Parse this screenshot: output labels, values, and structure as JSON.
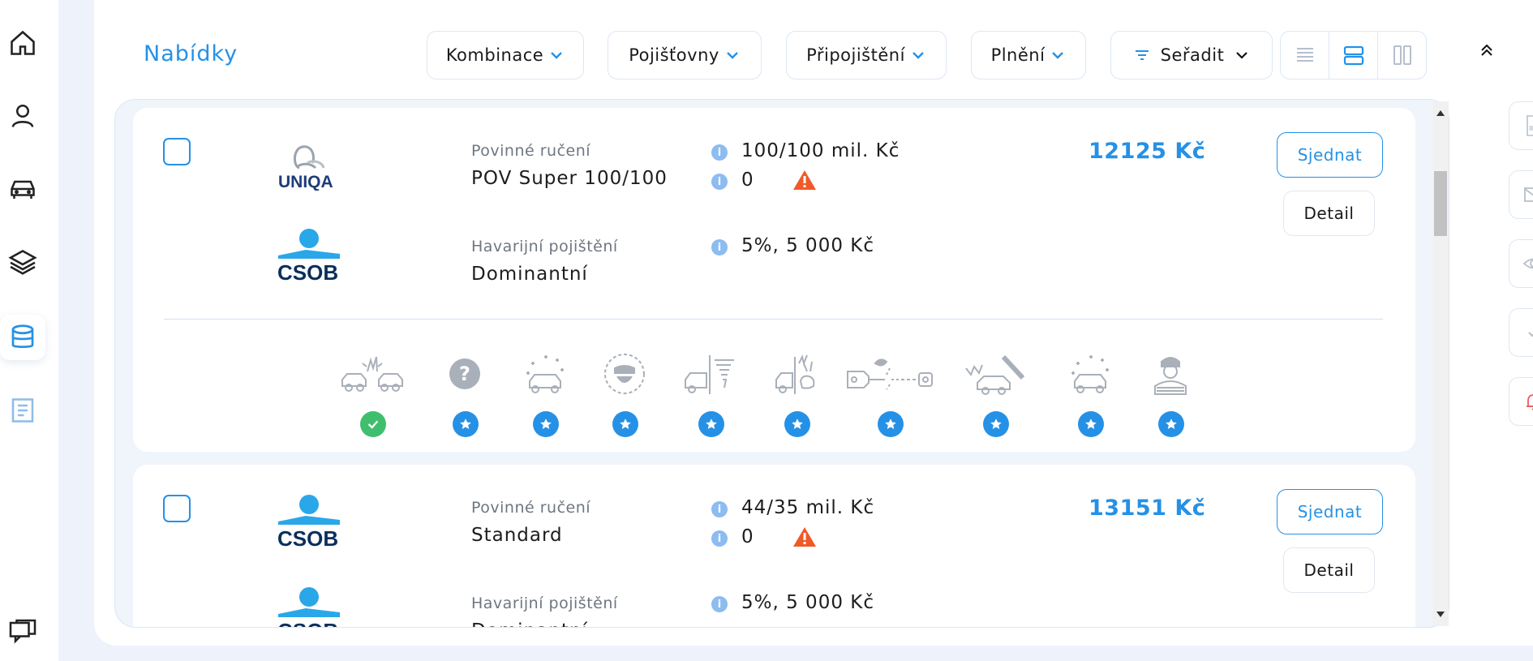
{
  "header": {
    "title": "Nabídky",
    "filters": [
      {
        "label": "Kombinace"
      },
      {
        "label": "Pojišťovny"
      },
      {
        "label": "Připojištění"
      },
      {
        "label": "Plnění"
      }
    ],
    "sort_label": "Seřadit"
  },
  "nav": {
    "items": [
      "home-icon",
      "user-icon",
      "car-icon",
      "layers-icon",
      "database-icon",
      "document-icon",
      "chat-icon"
    ],
    "active": "database-icon"
  },
  "right_rail": [
    "pdf-icon",
    "mail-icon",
    "eye-icon",
    "check-icon",
    "bell-icon"
  ],
  "offers": [
    {
      "mtpl": {
        "insurer": "UNIQA",
        "type_label": "Povinné ručení",
        "product": "POV Super 100/100",
        "limit": "100/100 mil. Kč",
        "deductible": "0"
      },
      "casco": {
        "insurer": "CSOB",
        "type_label": "Havarijní pojištění",
        "product": "Dominantní",
        "deductible": "5%, 5 000 Kč"
      },
      "price": "12125 Kč",
      "actions": {
        "primary": "Sjednat",
        "secondary": "Detail"
      },
      "features": [
        {
          "icon": "collision-icon",
          "status": "included"
        },
        {
          "icon": "question-icon",
          "status": "star"
        },
        {
          "icon": "natural-disaster-icon",
          "status": "star"
        },
        {
          "icon": "theft-icon",
          "status": "star"
        },
        {
          "icon": "storm-tornado-icon",
          "status": "star"
        },
        {
          "icon": "animal-collision-icon",
          "status": "star"
        },
        {
          "icon": "cable-damage-icon",
          "status": "star"
        },
        {
          "icon": "vandalism-icon",
          "status": "star"
        },
        {
          "icon": "hail-icon",
          "status": "star"
        },
        {
          "icon": "thief-icon",
          "status": "star"
        }
      ]
    },
    {
      "mtpl": {
        "insurer": "CSOB",
        "type_label": "Povinné ručení",
        "product": "Standard",
        "limit": "44/35 mil. Kč",
        "deductible": "0"
      },
      "casco": {
        "insurer": "CSOB",
        "type_label": "Havarijní pojištění",
        "product": "Dominantní",
        "deductible": "5%, 5 000 Kč"
      },
      "price": "13151 Kč",
      "actions": {
        "primary": "Sjednat",
        "secondary": "Detail"
      }
    }
  ],
  "colors": {
    "accent": "#2591e6",
    "warning": "#f05a28",
    "ok": "#3fbf6e",
    "csob_navy": "#0a2f5c",
    "csob_blue": "#2aa7e8"
  }
}
